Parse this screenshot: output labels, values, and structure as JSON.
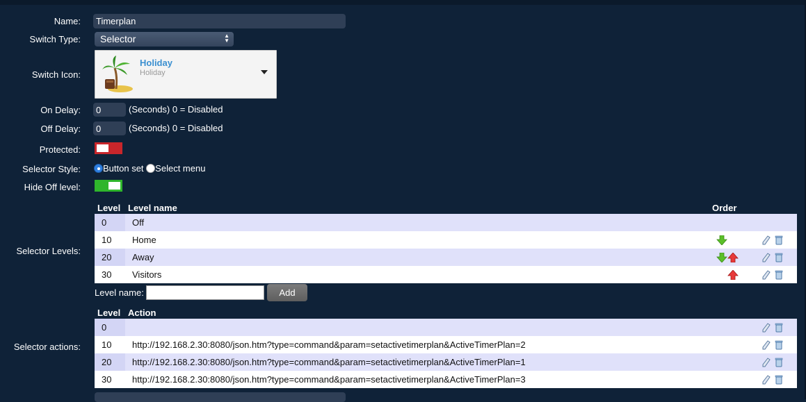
{
  "form": {
    "name_label": "Name:",
    "name_value": "Timerplan",
    "switch_type_label": "Switch Type:",
    "switch_type_value": "Selector",
    "switch_icon_label": "Switch Icon:",
    "icon_title": "Holiday",
    "icon_subtitle": "Holiday",
    "on_delay_label": "On Delay:",
    "on_delay_value": "0",
    "on_delay_hint": "(Seconds) 0 = Disabled",
    "off_delay_label": "Off Delay:",
    "off_delay_value": "0",
    "off_delay_hint": "(Seconds) 0 = Disabled",
    "protected_label": "Protected:",
    "protected_on": false,
    "selector_style_label": "Selector Style:",
    "style_option_1": "Button set",
    "style_option_2": "Select menu",
    "style_selected": "Button set",
    "hide_off_label": "Hide Off level:",
    "hide_off_on": true,
    "selector_levels_label": "Selector Levels:",
    "selector_actions_label": "Selector actions:"
  },
  "levels": {
    "headers": {
      "level": "Level",
      "name": "Level name",
      "order": "Order"
    },
    "rows": [
      {
        "level": "0",
        "name": "Off",
        "down": false,
        "up": false,
        "editable": false
      },
      {
        "level": "10",
        "name": "Home",
        "down": true,
        "up": false,
        "editable": true
      },
      {
        "level": "20",
        "name": "Away",
        "down": true,
        "up": true,
        "editable": true
      },
      {
        "level": "30",
        "name": "Visitors",
        "down": false,
        "up": true,
        "editable": true
      }
    ],
    "level_name_label": "Level name:",
    "level_name_value": "",
    "add_label": "Add"
  },
  "actions": {
    "headers": {
      "level": "Level",
      "action": "Action"
    },
    "rows": [
      {
        "level": "0",
        "action": ""
      },
      {
        "level": "10",
        "action": "http://192.168.2.30:8080/json.htm?type=command&param=setactivetimerplan&ActiveTimerPlan=2"
      },
      {
        "level": "20",
        "action": "http://192.168.2.30:8080/json.htm?type=command&param=setactivetimerplan&ActiveTimerPlan=1"
      },
      {
        "level": "30",
        "action": "http://192.168.2.30:8080/json.htm?type=command&param=setactivetimerplan&ActiveTimerPlan=3"
      }
    ]
  },
  "colors": {
    "background": "#0f2238",
    "toggle_off": "#c8262b",
    "toggle_on": "#2fb52c",
    "arrow_down": "#5bbf2a",
    "arrow_up": "#e83a3a",
    "row_odd": "#e0e1fa",
    "row_even": "#ffffff"
  }
}
